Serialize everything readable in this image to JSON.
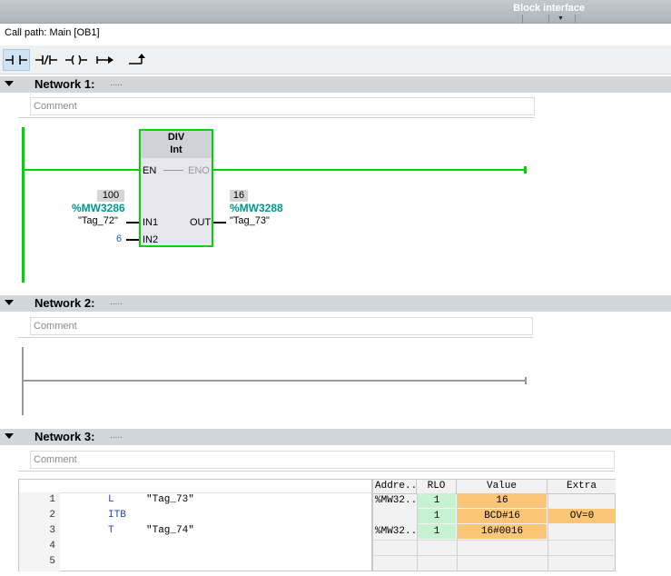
{
  "header": {
    "title": "Block interface"
  },
  "call_path": "Call path: Main [OB1]",
  "toolbar": {
    "icons": [
      "no-contact-icon",
      "nc-contact-icon",
      "coil-icon",
      "branch-open-icon",
      "branch-close-icon"
    ]
  },
  "networks": [
    {
      "label": "Network 1:",
      "dots": ".....",
      "comment": "Comment"
    },
    {
      "label": "Network 2:",
      "dots": ".....",
      "comment": "Comment"
    },
    {
      "label": "Network 3:",
      "dots": ".....",
      "comment": "Comment"
    }
  ],
  "div_block": {
    "name": "DIV",
    "type": "Int",
    "en": "EN",
    "eno": "ENO",
    "in1": "IN1",
    "in2": "IN2",
    "out": "OUT",
    "in1_value": "100",
    "in1_address": "%MW3286",
    "in1_tag": "\"Tag_72\"",
    "in2_value": "6",
    "out_value": "16",
    "out_address": "%MW3288",
    "out_tag": "\"Tag_73\""
  },
  "stl": {
    "lines": [
      {
        "n": "1",
        "instr": "L",
        "operand": "\"Tag_73\""
      },
      {
        "n": "2",
        "instr": "ITB",
        "operand": ""
      },
      {
        "n": "3",
        "instr": "T",
        "operand": "\"Tag_74\""
      },
      {
        "n": "4",
        "instr": "",
        "operand": ""
      },
      {
        "n": "5",
        "instr": "",
        "operand": ""
      }
    ],
    "headers": {
      "address": "Addre...",
      "rlo": "RLO",
      "value": "Value",
      "extra": "Extra"
    },
    "rows": [
      {
        "address": "%MW32...",
        "rlo": "1",
        "value": "16",
        "extra": ""
      },
      {
        "address": "",
        "rlo": "1",
        "value": "BCD#16",
        "extra": "OV=0"
      },
      {
        "address": "%MW32...",
        "rlo": "1",
        "value": "16#0016",
        "extra": ""
      }
    ]
  },
  "colors": {
    "status_green": "#00d400",
    "value_orange": "#fcc678",
    "rlo_green": "#c6f2d2",
    "address_teal": "#00978e"
  }
}
